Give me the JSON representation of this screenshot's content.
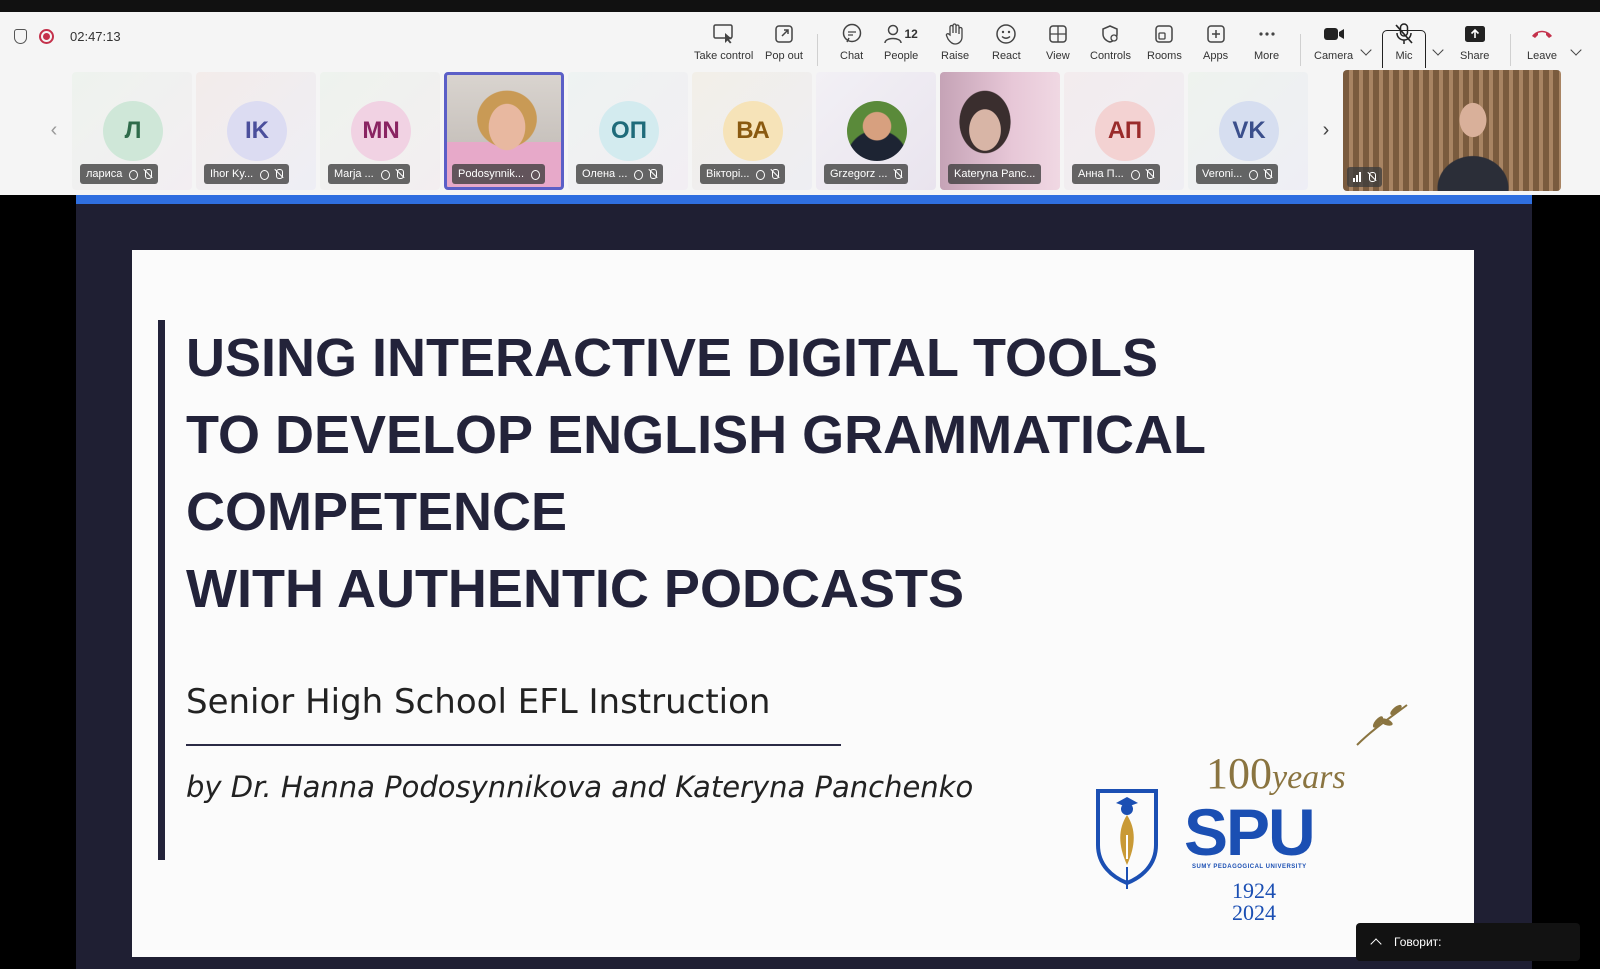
{
  "toolbar": {
    "timer": "02:47:13",
    "buttons": {
      "take_control": "Take control",
      "pop_out": "Pop out",
      "chat": "Chat",
      "people": "People",
      "people_count": "12",
      "raise": "Raise",
      "react": "React",
      "view": "View",
      "controls": "Controls",
      "rooms": "Rooms",
      "apps": "Apps",
      "more": "More",
      "camera": "Camera",
      "mic": "Mic",
      "share": "Share",
      "leave": "Leave"
    }
  },
  "gallery": {
    "participants": [
      {
        "initials": "Л",
        "name": "лариса",
        "color": "#2e6b4a",
        "bg": "#cfe7d8"
      },
      {
        "initials": "IK",
        "name": "Ihor Ky...",
        "color": "#4b4f9c",
        "bg": "#dcdcf2"
      },
      {
        "initials": "MN",
        "name": "Marja ...",
        "color": "#8a2462",
        "bg": "#f1d2e3"
      },
      {
        "initials": "",
        "name": "Podosynnik...",
        "color": "",
        "bg": ""
      },
      {
        "initials": "ОП",
        "name": "Олена ...",
        "color": "#1e6b7a",
        "bg": "#d3ebef"
      },
      {
        "initials": "ВА",
        "name": "Вікторі...",
        "color": "#8a5a10",
        "bg": "#f6e3b8"
      },
      {
        "initials": "",
        "name": "Grzegorz ...",
        "color": "",
        "bg": ""
      },
      {
        "initials": "",
        "name": "Kateryna Panc...",
        "color": "",
        "bg": ""
      },
      {
        "initials": "АП",
        "name": "Анна П...",
        "color": "#9a2b2b",
        "bg": "#f3d2d2"
      },
      {
        "initials": "VK",
        "name": "Veroni...",
        "color": "#3b4f8c",
        "bg": "#d6def0"
      }
    ]
  },
  "slide": {
    "title_lines": [
      "USING INTERACTIVE DIGITAL TOOLS",
      "TO DEVELOP ENGLISH GRAMMATICAL",
      "COMPETENCE",
      "WITH AUTHENTIC PODCASTS"
    ],
    "subtitle": "Senior High School EFL Instruction",
    "byline": "by Dr. Hanna Podosynnikova and Kateryna Panchenko",
    "logo": {
      "hundred": "100",
      "years": "years",
      "spu": "SPU",
      "university": "SUMY PEDAGOGICAL UNIVERSITY",
      "year_start": "1924",
      "year_end": "2024"
    }
  },
  "speaking_bar": {
    "label": "Говорит:"
  },
  "colors": {
    "accent": "#5b5fc7",
    "leave_red": "#c4314b",
    "slide_blue": "#2f6fe0",
    "slide_navy": "#23233a"
  }
}
